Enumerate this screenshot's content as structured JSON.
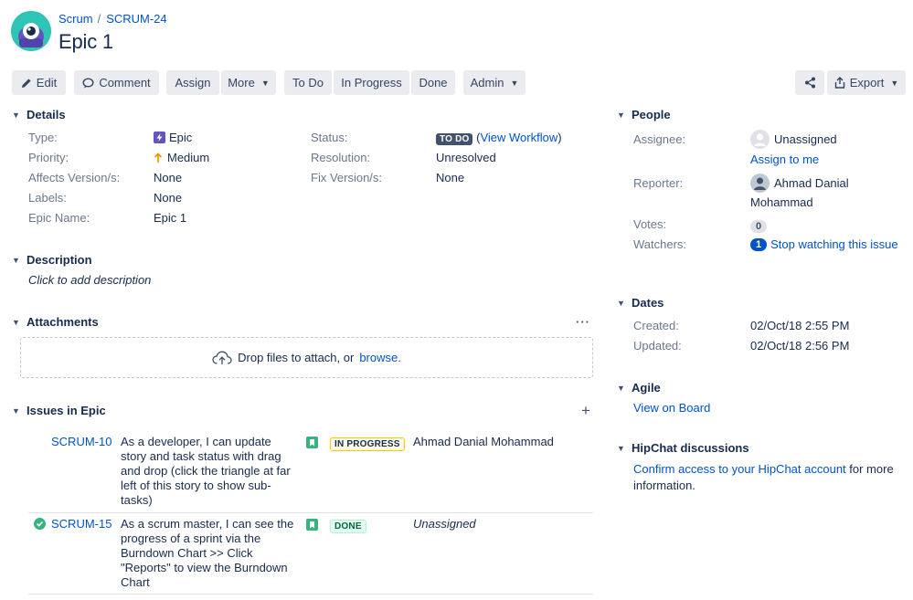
{
  "breadcrumb": {
    "project": "Scrum",
    "separator": "/",
    "issue_key": "SCRUM-24"
  },
  "issue": {
    "title": "Epic 1"
  },
  "toolbar": {
    "edit": "Edit",
    "comment": "Comment",
    "assign": "Assign",
    "more": "More",
    "todo": "To Do",
    "in_progress": "In Progress",
    "done": "Done",
    "admin": "Admin",
    "export": "Export"
  },
  "details": {
    "heading": "Details",
    "type_label": "Type:",
    "type_value": "Epic",
    "priority_label": "Priority:",
    "priority_value": "Medium",
    "affects_label": "Affects Version/s:",
    "affects_value": "None",
    "labels_label": "Labels:",
    "labels_value": "None",
    "epic_name_label": "Epic Name:",
    "epic_name_value": "Epic 1",
    "status_label": "Status:",
    "status_value": "TO DO",
    "view_workflow": "View Workflow",
    "resolution_label": "Resolution:",
    "resolution_value": "Unresolved",
    "fix_label": "Fix Version/s:",
    "fix_value": "None"
  },
  "description": {
    "heading": "Description",
    "placeholder": "Click to add description"
  },
  "attachments": {
    "heading": "Attachments",
    "drop_text": "Drop files to attach, or",
    "browse": "browse."
  },
  "issues_in_epic": {
    "heading": "Issues in Epic",
    "rows": [
      {
        "key": "SCRUM-10",
        "summary_lines": [
          "As a developer, I can update",
          "story and task status with drag",
          "and drop (click the triangle at far",
          "left of this story to show sub-",
          "tasks)"
        ],
        "status": "IN PROGRESS",
        "assignee": "Ahmad Danial Mohammad",
        "resolved": false
      },
      {
        "key": "SCRUM-15",
        "summary_lines": [
          "As a scrum master, I can see the",
          "progress of a sprint via the",
          "Burndown Chart >> Click",
          "\"Reports\" to view the Burndown",
          "Chart"
        ],
        "status": "DONE",
        "assignee": "Unassigned",
        "resolved": true
      }
    ]
  },
  "people": {
    "heading": "People",
    "assignee_label": "Assignee:",
    "assignee_value": "Unassigned",
    "assign_to_me": "Assign to me",
    "reporter_label": "Reporter:",
    "reporter_line1": "Ahmad Danial",
    "reporter_line2": "Mohammad",
    "votes_label": "Votes:",
    "votes_count": "0",
    "watchers_label": "Watchers:",
    "watchers_count": "1",
    "stop_watching": "Stop watching this issue"
  },
  "dates": {
    "heading": "Dates",
    "created_label": "Created:",
    "created_value": "02/Oct/18 2:55 PM",
    "updated_label": "Updated:",
    "updated_value": "02/Oct/18 2:56 PM"
  },
  "agile": {
    "heading": "Agile",
    "view_on_board": "View on Board"
  },
  "hipchat": {
    "heading": "HipChat discussions",
    "link": "Confirm access to your HipChat account",
    "suffix": " for more",
    "line2": "information."
  },
  "colors": {
    "link": "#0052cc",
    "text": "#172b4d",
    "muted": "#6b778c",
    "button_bg": "#ebecf0",
    "epic": "#6554c0",
    "story": "#36b37e",
    "priority_medium": "#ff8b00"
  }
}
